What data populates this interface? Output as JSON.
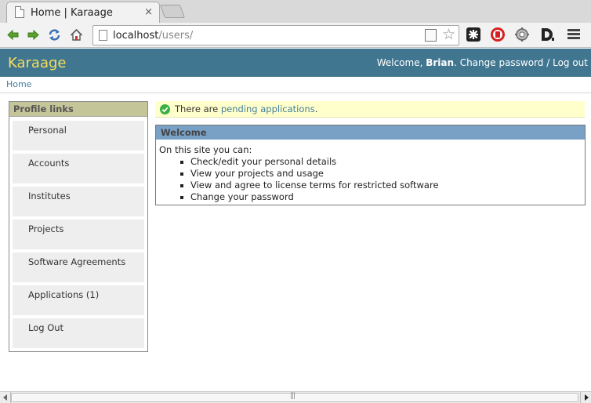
{
  "browser": {
    "tab_title": "Home | Karaage",
    "tab_close": "×",
    "url_host": "localhost",
    "url_path": "/users/",
    "star": "☆",
    "icons": [
      "back-icon",
      "forward-icon",
      "reload-icon",
      "home-icon",
      "star-icon",
      "puzzle-extension-icon",
      "stop-extension-icon",
      "gear-extension-icon",
      "d-extension-icon",
      "menu-icon"
    ]
  },
  "header": {
    "site_title": "Karaage",
    "welcome_prefix": "Welcome, ",
    "user_name": "Brian",
    "after_name": ". ",
    "change_password": "Change password",
    "separator": " / ",
    "logout": "Log out"
  },
  "breadcrumb": {
    "home": "Home"
  },
  "sidebar": {
    "heading": "Profile links",
    "items": [
      {
        "label": "Personal"
      },
      {
        "label": "Accounts"
      },
      {
        "label": "Institutes"
      },
      {
        "label": "Projects"
      },
      {
        "label": "Software Agreements"
      },
      {
        "label": "Applications (1)"
      },
      {
        "label": "Log Out"
      }
    ]
  },
  "message": {
    "prefix": "There are ",
    "link": "pending applications",
    "suffix": "."
  },
  "welcome": {
    "heading": "Welcome",
    "intro": "On this site you can:",
    "items": [
      "Check/edit your personal details",
      "View your projects and usage",
      "View and agree to license terms for restricted software",
      "Change your password"
    ]
  },
  "colors": {
    "header_bg": "#417690",
    "site_title": "#f5dd5d",
    "link": "#447e9b",
    "sidebar_head_bg": "#c5c59a",
    "welcome_head_bg": "#79a1c6",
    "message_bg": "#ffffcc",
    "success_icon": "#3cb043"
  }
}
